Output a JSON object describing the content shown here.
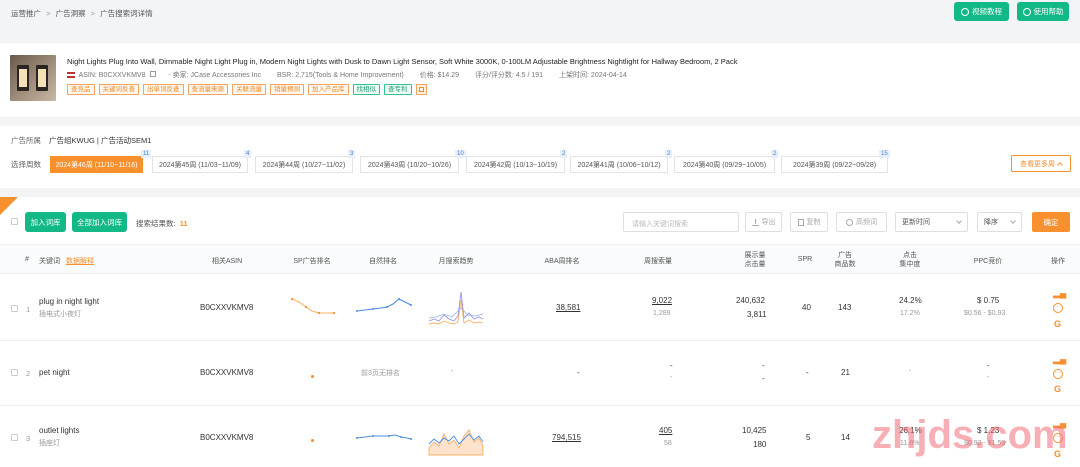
{
  "breadcrumb": [
    "运营推广",
    "广告洞察",
    "广告搜索词详情"
  ],
  "breadcrumb_sep": ">",
  "header_buttons": {
    "video": "视频教程",
    "help": "使用帮助"
  },
  "product": {
    "title": "Night Lights Plug Into Wall, Dimmable Night Light Plug in, Modern Night Lights with Dusk to Dawn Light Sensor, Soft White 3000K, 0-100LM Adjustable Brightness Nightlight for Hallway Bedroom, 2 Pack",
    "asin_label": "ASIN: B0CXXVKMV8",
    "seller_label": "- 卖家: JCase Accessories Inc",
    "bsr_label": "BSR: 2,715(Tools & Home Improvement)",
    "price_label": "价格: $14.29",
    "rating_label": "评分/评分数: 4.5 / 191",
    "date_label": "上架时间: 2024-04-14",
    "tags": [
      "查竞品",
      "关键词反查",
      "出单词反查",
      "查流量来源",
      "关联流量",
      "销量预测",
      "加入产品库"
    ],
    "tags_green": [
      "找相似",
      "查专利"
    ]
  },
  "ad_info": {
    "label": "广告所属",
    "value": "广告组KWUG | 广告活动SEM1"
  },
  "weeks": {
    "label": "选择周数",
    "items": [
      {
        "text": "2024第46周 (11/10~11/16)",
        "badge": "11"
      },
      {
        "text": "2024第45周 (11/03~11/09)",
        "badge": "4"
      },
      {
        "text": "2024第44周 (10/27~11/02)",
        "badge": "3"
      },
      {
        "text": "2024第43周 (10/20~10/26)",
        "badge": "10"
      },
      {
        "text": "2024第42周 (10/13~10/19)",
        "badge": "2"
      },
      {
        "text": "2024第41周 (10/06~10/12)",
        "badge": "2"
      },
      {
        "text": "2024第40周 (09/29~10/05)",
        "badge": "2"
      },
      {
        "text": "2024第39周 (09/22~09/28)",
        "badge": "15"
      }
    ],
    "more": "查看更多周"
  },
  "toolbar": {
    "add_lib": "加入词库",
    "add_all_lib": "全部加入词库",
    "result_label": "搜索结果数:",
    "result_count": "11",
    "search_placeholder": "请输入关键词搜索",
    "export": "导出",
    "copy": "复制",
    "high_freq": "高频词",
    "sort_field": "更新时间",
    "sort_order": "降序",
    "confirm": "确定"
  },
  "table": {
    "headers": {
      "idx": "#",
      "keyword": "关键词",
      "data_explain": "数据解释",
      "asin": "相关ASIN",
      "sp_rank": "SP广告排名",
      "nat_rank": "自然排名",
      "trend": "月搜索趋势",
      "aba": "ABA周排名",
      "weekly_search": "周搜索量",
      "impr1": "展示量",
      "impr2": "点击量",
      "spr": "SPR",
      "ad_products1": "广告",
      "ad_products2": "商品数",
      "click_conc1": "点击",
      "click_conc2": "集中度",
      "ppc": "PPC竞价",
      "ops": "操作"
    },
    "rows": [
      {
        "idx": "1",
        "keyword": "plug in night light",
        "kw_cn": "插电式小夜灯",
        "asin": "B0CXXVKMV8",
        "aba": "38,581",
        "search_main": "9,022",
        "search_sub": "1,289",
        "impr": "240,632",
        "clicks": "3,811",
        "spr": "40",
        "ad_count": "143",
        "conc_main": "24.2%",
        "conc_sub": "17.2%",
        "ppc_main": "$ 0.75",
        "ppc_sub": "$0.56 - $0.93"
      },
      {
        "idx": "2",
        "keyword": "pet night",
        "kw_cn": "",
        "asin": "B0CXXVKMV8",
        "nat_note": "前3页无排名",
        "trend": "-",
        "aba": "-",
        "search_main": "-",
        "search_sub": "-",
        "impr": "-",
        "clicks": "-",
        "spr": "-",
        "ad_count": "21",
        "conc_main": "-",
        "conc_sub": "",
        "ppc_main": "-",
        "ppc_sub": "-"
      },
      {
        "idx": "3",
        "keyword": "outlet lights",
        "kw_cn": "插座灯",
        "asin": "B0CXXVKMV8",
        "aba": "794,515",
        "search_main": "405",
        "search_sub": "58",
        "impr": "10,425",
        "clicks": "180",
        "spr": "5",
        "ad_count": "14",
        "conc_main": "26.1%",
        "conc_sub": "11.8%",
        "ppc_main": "$ 1.23",
        "ppc_sub": "$0.92 - $1.53"
      }
    ]
  },
  "watermark": "zhjds.com",
  "colors": {
    "accent": "#f7902d",
    "green": "#12b886",
    "blue": "#4a8de6",
    "purple": "#9b8fe6"
  }
}
